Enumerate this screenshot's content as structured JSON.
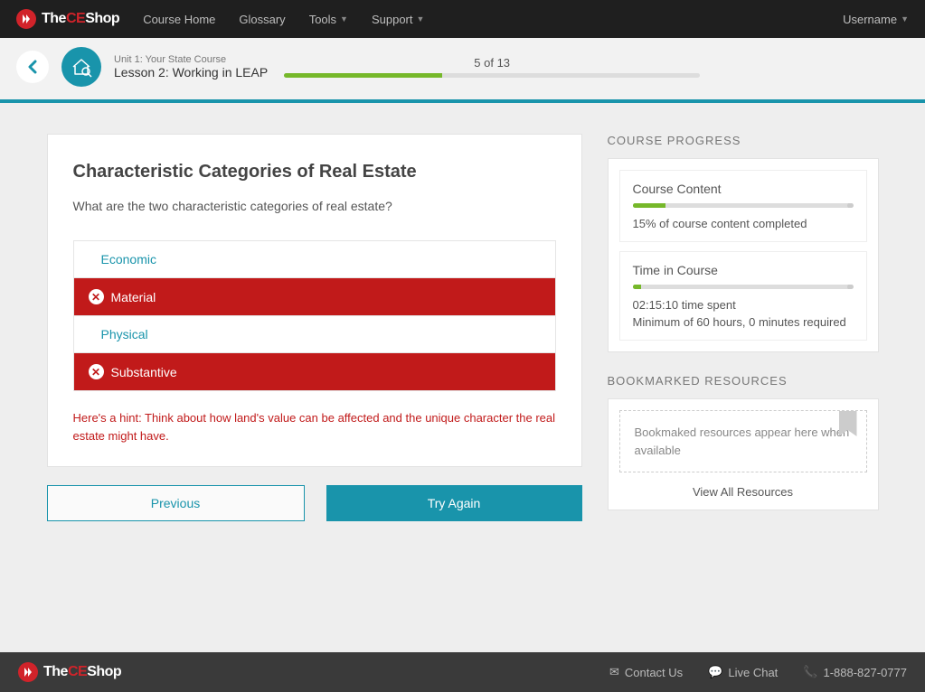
{
  "logo": {
    "the": "The",
    "ce": "CE",
    "shop": "Shop"
  },
  "nav": {
    "course_home": "Course Home",
    "glossary": "Glossary",
    "tools": "Tools",
    "support": "Support",
    "username": "Username"
  },
  "lesson": {
    "unit": "Unit 1: Your State Course",
    "title": "Lesson 2: Working in LEAP",
    "progress_label": "5 of 13",
    "progress_pct": 38
  },
  "quiz": {
    "title": "Characteristic Categories of Real Estate",
    "question": "What are the two characteristic categories of real estate?",
    "answers": [
      {
        "label": "Economic",
        "state": "neutral"
      },
      {
        "label": "Material",
        "state": "wrong"
      },
      {
        "label": "Physical",
        "state": "neutral"
      },
      {
        "label": "Substantive",
        "state": "wrong"
      }
    ],
    "hint": "Here's a hint: Think about how land's value can be affected and the unique character the real estate might have.",
    "previous": "Previous",
    "try_again": "Try Again"
  },
  "sidebar": {
    "course_progress_title": "COURSE PROGRESS",
    "content": {
      "label": "Course Content",
      "pct": 15,
      "text": "15% of course content completed"
    },
    "time": {
      "label": "Time in Course",
      "pct": 4,
      "spent": "02:15:10 time spent",
      "required": "Minimum of 60 hours, 0 minutes required"
    },
    "bookmarks_title": "BOOKMARKED RESOURCES",
    "bookmarks_empty": "Bookmaked resources appear here when available",
    "view_all": "View All Resources"
  },
  "footer": {
    "contact": "Contact Us",
    "chat": "Live Chat",
    "phone": "1-888-827-0777"
  }
}
